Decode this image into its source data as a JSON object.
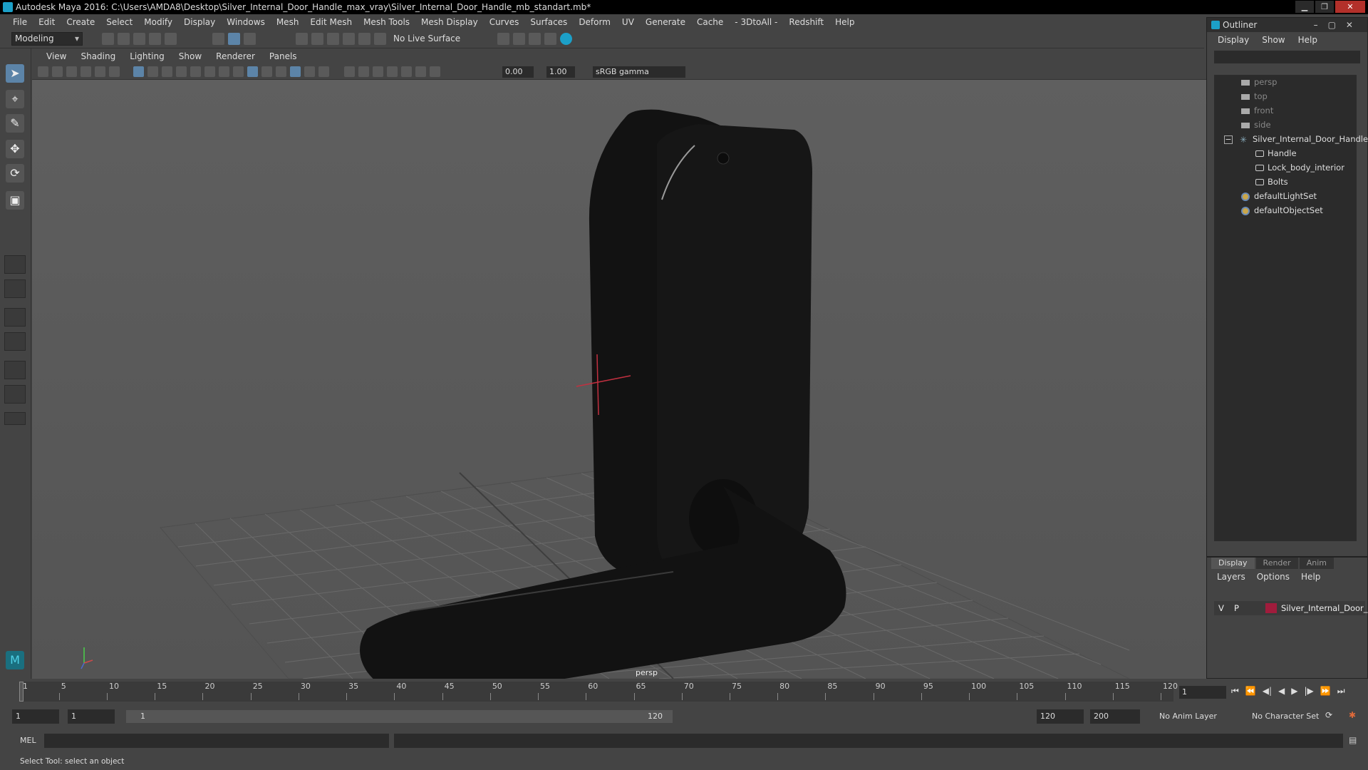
{
  "window": {
    "title": "Autodesk Maya 2016: C:\\Users\\AMDA8\\Desktop\\Silver_Internal_Door_Handle_max_vray\\Silver_Internal_Door_Handle_mb_standart.mb*"
  },
  "menubar": [
    "File",
    "Edit",
    "Create",
    "Select",
    "Modify",
    "Display",
    "Windows",
    "Mesh",
    "Edit Mesh",
    "Mesh Tools",
    "Mesh Display",
    "Curves",
    "Surfaces",
    "Deform",
    "UV",
    "Generate",
    "Cache",
    "- 3DtoAll -",
    "Redshift",
    "Help"
  ],
  "shelf": {
    "mode": "Modeling",
    "live_surface": "No Live Surface"
  },
  "viewport": {
    "menu": [
      "View",
      "Shading",
      "Lighting",
      "Show",
      "Renderer",
      "Panels"
    ],
    "exposure": "0.00",
    "gamma": "1.00",
    "color_space": "sRGB gamma",
    "camera_label": "persp"
  },
  "outliner": {
    "title": "Outliner",
    "menu": [
      "Display",
      "Show",
      "Help"
    ],
    "items": [
      {
        "label": "persp",
        "dim": true
      },
      {
        "label": "top",
        "dim": true
      },
      {
        "label": "front",
        "dim": true
      },
      {
        "label": "side",
        "dim": true
      },
      {
        "label": "Silver_Internal_Door_Handle"
      },
      {
        "label": "Handle"
      },
      {
        "label": "Lock_body_interior"
      },
      {
        "label": "Bolts"
      },
      {
        "label": "defaultLightSet"
      },
      {
        "label": "defaultObjectSet"
      }
    ]
  },
  "layers": {
    "tabs": [
      "Display",
      "Render",
      "Anim"
    ],
    "menu": [
      "Layers",
      "Options",
      "Help"
    ],
    "row": {
      "v": "V",
      "p": "P",
      "name": "Silver_Internal_Door_H",
      "color": "#a01c3c"
    }
  },
  "timeline": {
    "ticks": [
      "1",
      "5",
      "10",
      "15",
      "20",
      "25",
      "30",
      "35",
      "40",
      "45",
      "50",
      "55",
      "60",
      "65",
      "70",
      "75",
      "80",
      "85",
      "90",
      "95",
      "100",
      "105",
      "110",
      "115",
      "120"
    ],
    "current_frame": "1"
  },
  "range": {
    "start": "1",
    "playback_start": "1",
    "slider_in": "1",
    "slider_out": "120",
    "playback_end": "120",
    "end": "200",
    "anim_layer": "No Anim Layer",
    "character_set": "No Character Set"
  },
  "command_line": {
    "label": "MEL"
  },
  "status_line": "Select Tool: select an object"
}
